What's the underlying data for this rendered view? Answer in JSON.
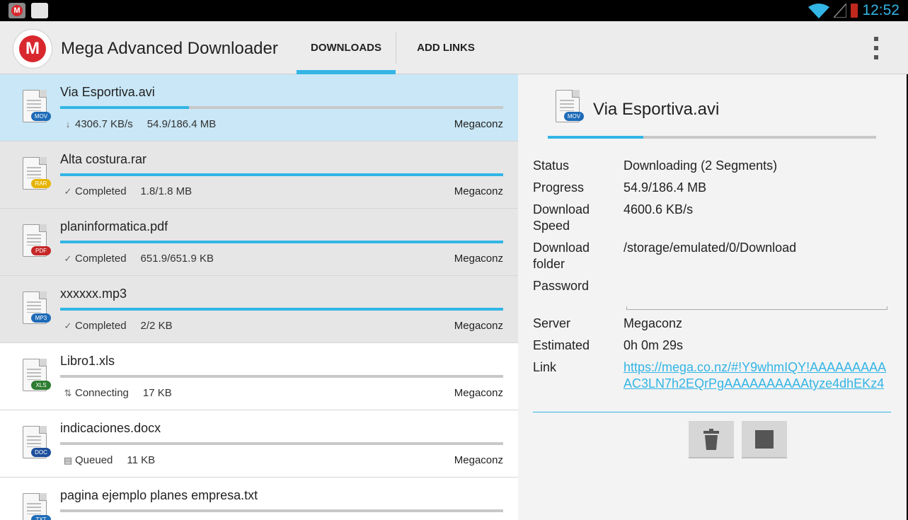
{
  "status_bar": {
    "time": "12:52",
    "left_icons": [
      "mega-notification-icon",
      "shopping-bag-icon"
    ],
    "right_icons": [
      "wifi-icon",
      "cell-signal-icon",
      "battery-low-icon"
    ],
    "time_color": "#33b5e5"
  },
  "action_bar": {
    "logo_letter": "M",
    "title": "Mega Advanced Downloader",
    "tabs": [
      {
        "label": "DOWNLOADS",
        "selected": true
      },
      {
        "label": "ADD LINKS",
        "selected": false
      }
    ],
    "overflow_icon": "more-vert-icon"
  },
  "colors": {
    "accent": "#33b5e5",
    "brand_red": "#d9272e",
    "selected_row": "#c9e7f6",
    "completed_row": "#e6e6e6"
  },
  "downloads": [
    {
      "name": "Via Esportiva.avi",
      "type": "MOV",
      "badge_color": "#1e6bb8",
      "status": "4306.7 KB/s",
      "status_icon": "download-arrow-icon",
      "size": "54.9/186.4 MB",
      "server": "Megaconz",
      "progress": 0.29,
      "state": "selected"
    },
    {
      "name": "Alta costura.rar",
      "type": "RAR",
      "badge_color": "#e6b400",
      "status": "Completed",
      "status_icon": "check-icon",
      "size": "1.8/1.8 MB",
      "server": "Megaconz",
      "progress": 1.0,
      "state": "done"
    },
    {
      "name": "planinformatica.pdf",
      "type": "PDF",
      "badge_color": "#c62828",
      "status": "Completed",
      "status_icon": "check-icon",
      "size": "651.9/651.9 KB",
      "server": "Megaconz",
      "progress": 1.0,
      "state": "done"
    },
    {
      "name": "xxxxxx.mp3",
      "type": "MP3",
      "badge_color": "#1e6bb8",
      "status": "Completed",
      "status_icon": "check-icon",
      "size": "2/2 KB",
      "server": "Megaconz",
      "progress": 1.0,
      "state": "done"
    },
    {
      "name": "Libro1.xls",
      "type": "XLS",
      "badge_color": "#2e7d32",
      "status": "Connecting",
      "status_icon": "connecting-arrows-icon",
      "size": "17 KB",
      "server": "Megaconz",
      "progress": 0.0,
      "state": "plain"
    },
    {
      "name": "indicaciones.docx",
      "type": "DOC",
      "badge_color": "#1e4f9c",
      "status": "Queued",
      "status_icon": "queue-icon",
      "size": "11 KB",
      "server": "Megaconz",
      "progress": 0.0,
      "state": "plain"
    },
    {
      "name": "pagina ejemplo planes empresa.txt",
      "type": "TXT",
      "badge_color": "#1e6bb8",
      "status": "",
      "status_icon": "",
      "size": "",
      "server": "",
      "progress": 0.0,
      "state": "plain"
    }
  ],
  "detail": {
    "file_name": "Via Esportiva.avi",
    "file_type": "MOV",
    "progress": 0.29,
    "fields": {
      "status_label": "Status",
      "status_value": "Downloading (2 Segments)",
      "progress_label": "Progress",
      "progress_value": "54.9/186.4 MB",
      "speed_label_1": "Download",
      "speed_label_2": "Speed",
      "speed_value": "4600.6 KB/s",
      "folder_label_1": "Download",
      "folder_label_2": "folder",
      "folder_value": "/storage/emulated/0/Download",
      "password_label": "Password",
      "password_value": "",
      "server_label": "Server",
      "server_value": "Megaconz",
      "estimated_label": "Estimated",
      "estimated_value": "0h 0m 29s",
      "link_label": "Link",
      "link_value": "https://mega.co.nz/#!Y9whmIQY!AAAAAAAAAAC3LN7h2EQrPgAAAAAAAAAAtyze4dhEKz4"
    },
    "buttons": [
      {
        "name": "delete-button",
        "icon": "trash-icon"
      },
      {
        "name": "stop-button",
        "icon": "stop-icon"
      }
    ]
  }
}
